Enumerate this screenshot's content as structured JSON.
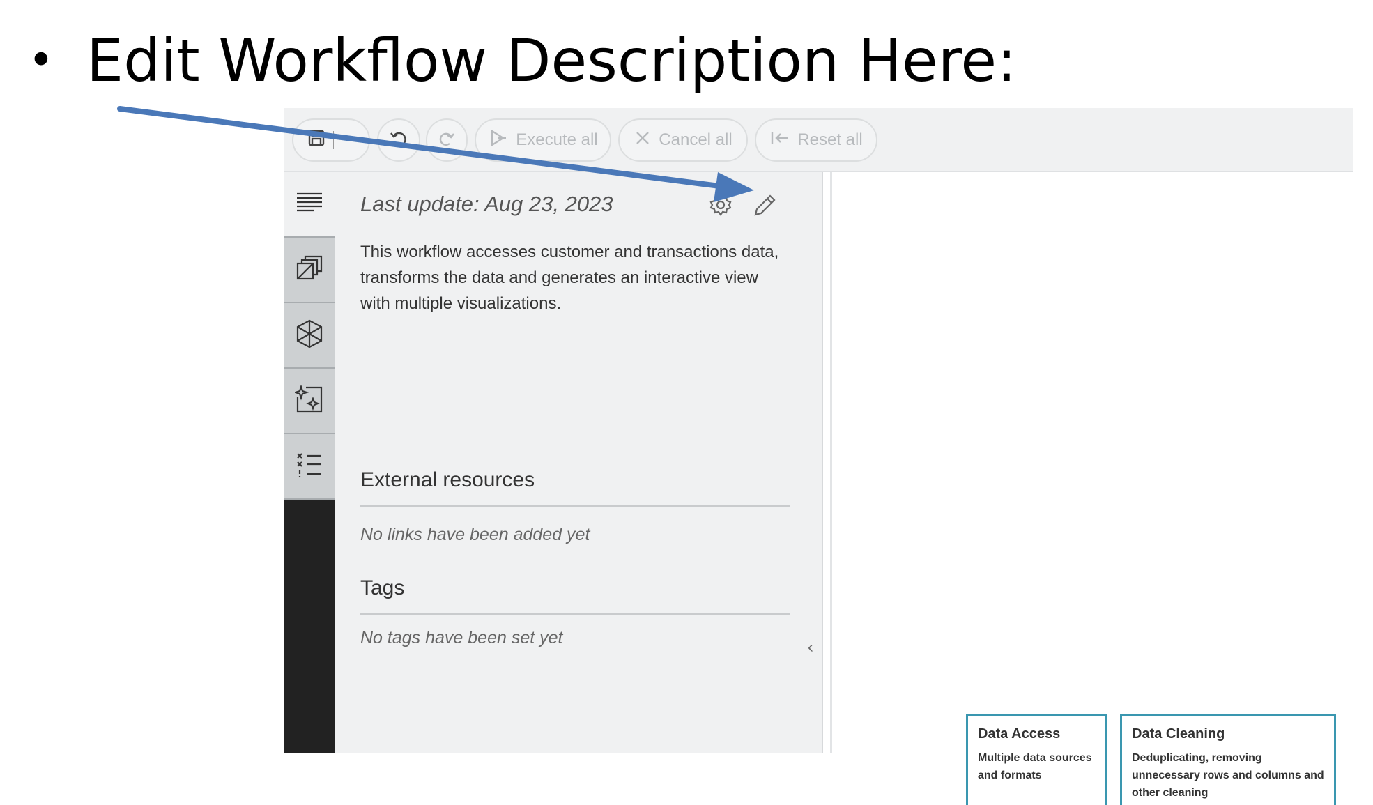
{
  "slide": {
    "bullet": "•",
    "heading": "Edit Workflow Description Here:"
  },
  "toolbar": {
    "execute_all": "Execute all",
    "cancel_all": "Cancel all",
    "reset_all": "Reset all"
  },
  "panel": {
    "last_update": "Last update: Aug 23, 2023",
    "description": "This workflow accesses customer and transactions data, transforms the data and generates an interactive view with multiple visualizations.",
    "external_resources_title": "External resources",
    "no_links": "No links have been added yet",
    "tags_title": "Tags",
    "no_tags": "No tags have been set yet",
    "collapse_glyph": "‹"
  },
  "cards": [
    {
      "title": "Data Access",
      "desc": "Multiple data sources and formats"
    },
    {
      "title": "Data Cleaning",
      "desc": "Deduplicating, removing unnecessary rows and columns and other cleaning"
    }
  ],
  "icons": {
    "rail": [
      "description-icon",
      "space-explorer-icon",
      "node-repository-icon",
      "ai-assistant-icon",
      "workflow-monitor-icon"
    ],
    "toolbar": [
      "save-icon",
      "chevron-down-icon",
      "undo-icon",
      "redo-icon",
      "execute-all-icon",
      "cancel-icon",
      "reset-icon"
    ],
    "panel": [
      "gear-icon",
      "pencil-icon"
    ]
  },
  "colors": {
    "annotation_arrow": "#4a78b8",
    "card_border": "#3a97b0",
    "rail_dark": "#222222"
  }
}
